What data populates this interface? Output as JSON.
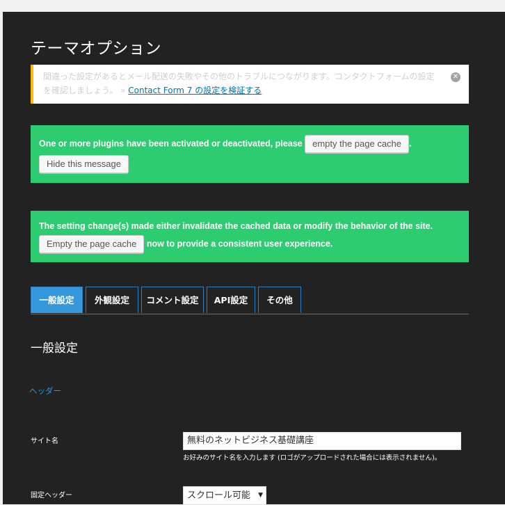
{
  "page": {
    "title": "テーマオプション"
  },
  "notice": {
    "text": "間違った設定があるとメール配送の失敗やその他のトラブルにつながります。コンタクトフォームの設定を確認しましょう。 » ",
    "link_text": "Contact Form 7 の設定を検証する",
    "dismiss_icon": "close-circle-icon",
    "border_color": "#ffb900"
  },
  "cache_notice_1": {
    "text": "One or more plugins have been activated or deactivated, please",
    "button_label": "empty the page cache",
    "trailing": ".",
    "hide_button_label": "Hide this message"
  },
  "cache_notice_2": {
    "text": "The setting change(s) made either invalidate the cached data or modify the behavior of the site.",
    "button_label": "Empty the page cache",
    "trailing": "now to provide a consistent user experience."
  },
  "tabs": [
    {
      "label": "一般設定",
      "active": true
    },
    {
      "label": "外観設定",
      "active": false
    },
    {
      "label": "コメント設定",
      "active": false
    },
    {
      "label": "API設定",
      "active": false
    },
    {
      "label": "その他",
      "active": false
    }
  ],
  "section": {
    "title": "一般設定",
    "subsection": "ヘッダー"
  },
  "fields": {
    "site_name": {
      "label": "サイト名",
      "value": "無料のネットビジネス基礎講座",
      "help": "お好みのサイト名を入力します (ロゴがアップロードされた場合には表示されません)。"
    },
    "fixed_header": {
      "label": "固定ヘッダー",
      "selected": "スクロール可能"
    }
  },
  "colors": {
    "background": "#222222",
    "green": "#2ecc71",
    "accent": "#3498db"
  }
}
